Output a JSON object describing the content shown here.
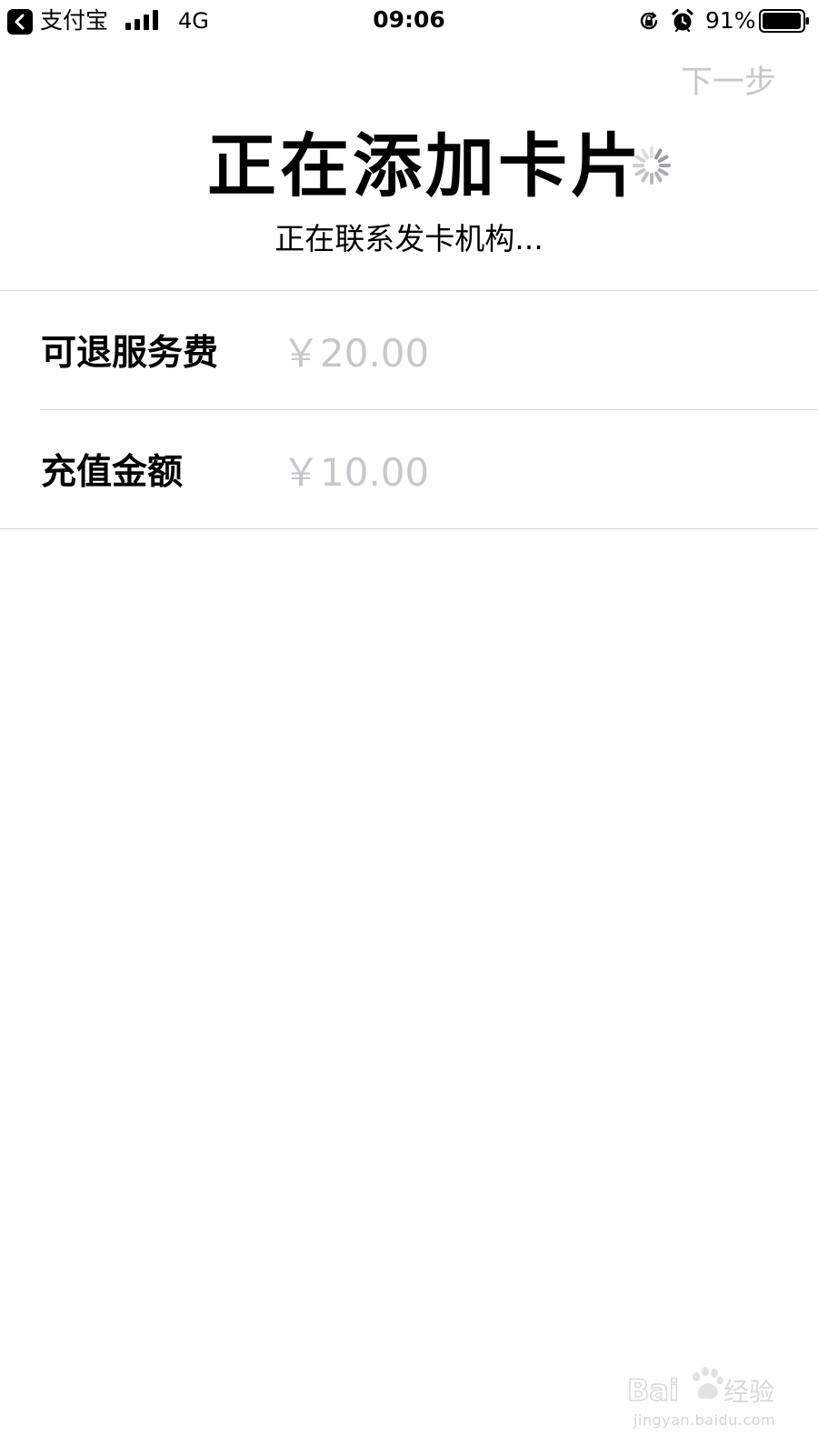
{
  "status_bar": {
    "back_app": "支付宝",
    "network": "4G",
    "time": "09:06",
    "battery_percent": "91%",
    "icons": [
      "back-arrow-icon",
      "signal-icon",
      "rotation-lock-icon",
      "alarm-icon",
      "battery-icon"
    ]
  },
  "header": {
    "next_label": "下一步",
    "title": "正在添加卡片",
    "subtitle": "正在联系发卡机构..."
  },
  "list": {
    "rows": [
      {
        "label": "可退服务费",
        "value": "￥20.00"
      },
      {
        "label": "充值金额",
        "value": "￥10.00"
      }
    ]
  },
  "watermark": {
    "logo_text": "Baidu经验",
    "url": "jingyan.baidu.com"
  },
  "colors": {
    "text": "#000000",
    "muted": "#c7c7cc",
    "divider": "#d6d6d6",
    "background": "#ffffff"
  }
}
